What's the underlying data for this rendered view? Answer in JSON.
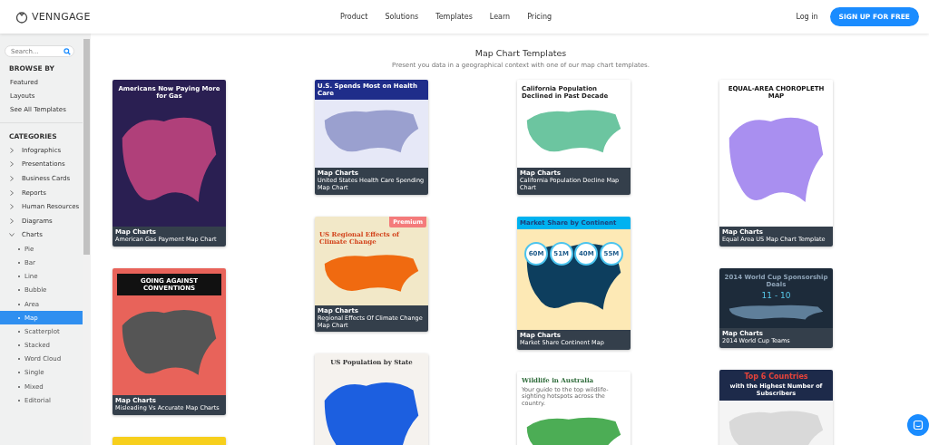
{
  "header": {
    "logo": "VENNGAGE",
    "nav": [
      "Product",
      "Solutions",
      "Templates",
      "Learn",
      "Pricing"
    ],
    "login": "Log in",
    "cta": "SIGN UP FOR FREE"
  },
  "sidebar": {
    "search": {
      "placeholder": "Search..."
    },
    "browse_title": "BROWSE BY",
    "browse": [
      "Featured",
      "Layouts",
      "See All Templates"
    ],
    "categories_title": "CATEGORIES",
    "categories": [
      {
        "label": "Infographics",
        "expanded": false
      },
      {
        "label": "Presentations",
        "expanded": false
      },
      {
        "label": "Business Cards",
        "expanded": false
      },
      {
        "label": "Reports",
        "expanded": false
      },
      {
        "label": "Human Resources",
        "expanded": false
      },
      {
        "label": "Diagrams",
        "expanded": false
      },
      {
        "label": "Charts",
        "expanded": true,
        "children": [
          {
            "label": "Pie",
            "selected": false
          },
          {
            "label": "Bar",
            "selected": false
          },
          {
            "label": "Line",
            "selected": false
          },
          {
            "label": "Bubble",
            "selected": false
          },
          {
            "label": "Area",
            "selected": false
          },
          {
            "label": "Map",
            "selected": true
          },
          {
            "label": "Scatterplot",
            "selected": false
          },
          {
            "label": "Stacked",
            "selected": false
          },
          {
            "label": "Word Cloud",
            "selected": false
          },
          {
            "label": "Single",
            "selected": false
          },
          {
            "label": "Mixed",
            "selected": false
          },
          {
            "label": "Editorial",
            "selected": false
          }
        ]
      }
    ]
  },
  "content": {
    "title": "Map Chart Templates",
    "subtitle": "Present you data in a geographical context with one of our map chart templates.",
    "columns": [
      [
        {
          "kind": "gas",
          "heading": "Americans Now Paying More for Gas",
          "category": "Map Charts",
          "title": "American Gas Payment Map Chart"
        },
        {
          "kind": "conventions",
          "heading": "GOING AGAINST CONVENTIONS",
          "category": "Map Charts",
          "title": "Misleading Vs Accurate Map Charts"
        },
        {
          "kind": "yellow"
        }
      ],
      [
        {
          "kind": "health",
          "heading": "U.S. Spends Most on Health Care",
          "category": "Map Charts",
          "title": "United States Health Care Spending Map Chart"
        },
        {
          "kind": "climate",
          "heading": "US Regional Effects of Climate Change",
          "badge": "Premium",
          "category": "Map Charts",
          "title": "Regional Effects Of Climate Change Map Chart"
        },
        {
          "kind": "population",
          "heading": "US Population by State"
        }
      ],
      [
        {
          "kind": "california",
          "heading": "California Population Declined in Past Decade",
          "category": "Map Charts",
          "title": "California Population Decline Map Chart"
        },
        {
          "kind": "market",
          "heading": "Market Share by Continent",
          "bubbles": [
            "60M",
            "51M",
            "40M",
            "55M"
          ],
          "category": "Map Charts",
          "title": "Market Share Continent Map"
        },
        {
          "kind": "wildlife",
          "heading": "Wildlife in Australia",
          "subheading": "Your guide to the top wildlife-sighting hotspots across the country."
        }
      ],
      [
        {
          "kind": "choropleth",
          "heading": "EQUAL-AREA CHOROPLETH MAP",
          "category": "Map Charts",
          "title": "Equal Area US Map Chart Template"
        },
        {
          "kind": "worldcup",
          "heading": "2014 World Cup Sponsorship Deals",
          "score": "11 - 10",
          "category": "Map Charts",
          "title": "2014 World Cup Teams"
        },
        {
          "kind": "countries",
          "heading": "Top 6 Countries",
          "subheading": "with the Highest Number of Subscribers"
        }
      ]
    ]
  }
}
